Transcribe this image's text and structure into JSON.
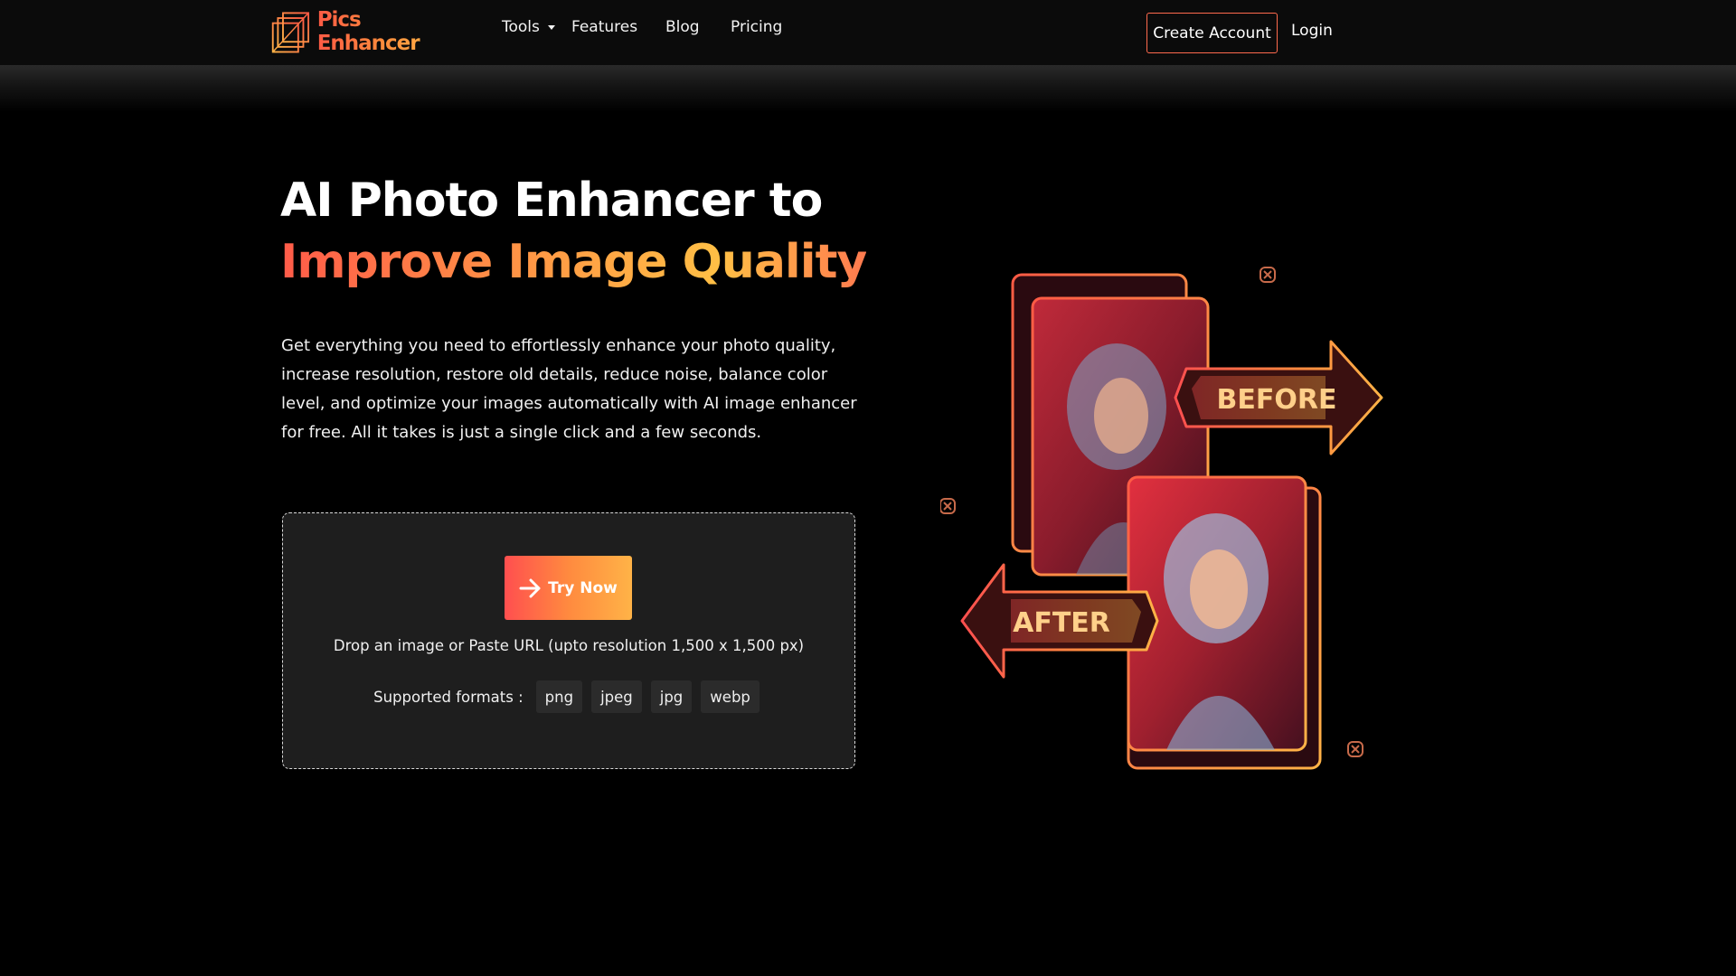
{
  "brand": {
    "name": "Pics Enhancer"
  },
  "nav": {
    "tools": "Tools",
    "features": "Features",
    "blog": "Blog",
    "pricing": "Pricing",
    "create_account": "Create Account",
    "login": "Login"
  },
  "hero": {
    "title_line1": "AI Photo Enhancer to",
    "title_line2": "Improve Image Quality",
    "description": "Get everything you need to effortlessly enhance your photo quality, increase resolution, restore old details, reduce noise, balance color level, and optimize your images automatically with AI image enhancer for free. All it takes is just a single click and a few seconds."
  },
  "upload": {
    "button_label": "Try Now",
    "drop_text": "Drop an image or Paste URL (upto resolution 1,500 x 1,500 px)",
    "formats_label": "Supported formats :",
    "formats": [
      "png",
      "jpeg",
      "jpg",
      "webp"
    ]
  },
  "illustration": {
    "before_label": "BEFORE",
    "after_label": "AFTER"
  },
  "colors": {
    "background": "#000000",
    "panel": "#1e1e1e",
    "accent_red": "#ff4f4f",
    "accent_orange": "#ff8a3f",
    "accent_yellow": "#ffb347",
    "border_orange": "#ff6a4d"
  },
  "icons": {
    "try_now": "arrow-right-icon",
    "tools_dropdown": "caret-down-icon",
    "logo": "layered-squares-logo-icon",
    "decoration": "close-x-icon"
  }
}
